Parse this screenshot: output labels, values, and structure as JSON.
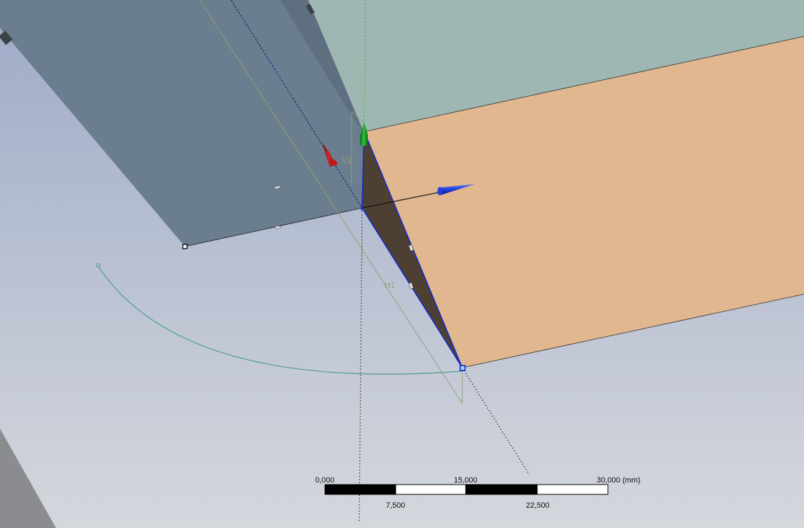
{
  "colors": {
    "background_top": "#9eaac8",
    "background_bottom": "#d4d7dc",
    "face_grey": "#6b7e8f",
    "face_grey_dark": "#5e707f",
    "face_teal": "#9fb7b2",
    "face_orange": "#e0b78f",
    "face_dark": "#4d4033",
    "edge_blue": "#1428c8",
    "dimension_green": "#8fa070",
    "arc_teal": "#4f9a8e",
    "axis_red": "#d21e1e",
    "axis_green": "#1fa02a",
    "axis_blue": "#1e3cdc"
  },
  "dimensions": {
    "h1_label": "H1",
    "v_label": "V2"
  },
  "scale_bar": {
    "label_0": "0,000",
    "label_7500": "7,500",
    "label_15000": "15,000",
    "label_22500": "22,500",
    "label_30000": "30,000 (mm)"
  },
  "icons": {
    "axis_x": "red-cone-arrow",
    "axis_y": "green-cone-arrow",
    "axis_z": "blue-cone-arrow"
  }
}
